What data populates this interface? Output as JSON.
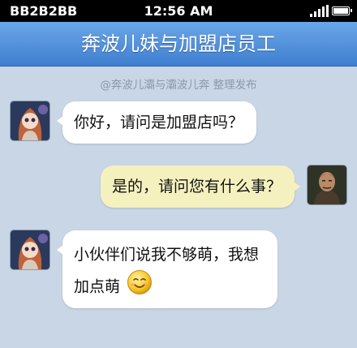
{
  "status_bar": {
    "carrier": "BB2B2BB",
    "time": "12:56 AM"
  },
  "chat": {
    "title": "奔波儿妹与加盟店员工",
    "watermark": "@奔波儿灞与灞波儿奔 整理发布",
    "messages": [
      {
        "side": "left",
        "text": "你好，请问是加盟店吗？"
      },
      {
        "side": "right",
        "text": "是的，请问您有什么事？"
      },
      {
        "side": "left",
        "line1": "小伙伴们说我不够萌，我想",
        "line2": "加点萌",
        "emoji": "smiley-icon"
      }
    ]
  },
  "colors": {
    "background": "#c9d6e6",
    "titlebar": "#4d8ddb",
    "bubble_left": "#ffffff",
    "bubble_right": "#f5f1bf"
  }
}
